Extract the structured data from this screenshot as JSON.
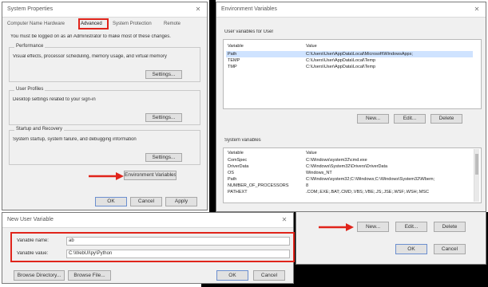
{
  "sysprops": {
    "title": "System Properties",
    "tabs": [
      "Computer Name",
      "Hardware",
      "Advanced",
      "System Protection",
      "Remote"
    ],
    "active_tab": "Advanced",
    "intro": "You must be logged on as an Administrator to make most of these changes.",
    "performance": {
      "label": "Performance",
      "desc": "Visual effects, processor scheduling, memory usage, and virtual memory",
      "button": "Settings..."
    },
    "profiles": {
      "label": "User Profiles",
      "desc": "Desktop settings related to your sign-in",
      "button": "Settings..."
    },
    "startup": {
      "label": "Startup and Recovery",
      "desc": "System startup, system failure, and debugging information",
      "button": "Settings..."
    },
    "env_button": "Environment Variables...",
    "ok": "OK",
    "cancel": "Cancel",
    "apply": "Apply"
  },
  "envvars": {
    "title": "Environment Variables",
    "user_section": "User variables for User",
    "col_variable": "Variable",
    "col_value": "Value",
    "user_vars": [
      {
        "name": "Path",
        "value": "C:\\Users\\User\\AppData\\Local\\Microsoft\\WindowsApps;"
      },
      {
        "name": "TEMP",
        "value": "C:\\Users\\User\\AppData\\Local\\Temp"
      },
      {
        "name": "TMP",
        "value": "C:\\Users\\User\\AppData\\Local\\Temp"
      }
    ],
    "user_buttons": [
      "New...",
      "Edit...",
      "Delete"
    ],
    "system_section": "System variables",
    "system_vars": [
      {
        "name": "Variable",
        "value": "Value"
      },
      {
        "name": "ComSpec",
        "value": "C:\\Windows\\system32\\cmd.exe"
      },
      {
        "name": "DriverData",
        "value": "C:\\Windows\\System32\\Drivers\\DriverData"
      },
      {
        "name": "OS",
        "value": "Windows_NT"
      },
      {
        "name": "Path",
        "value": "C:\\Windows\\system32;C:\\Windows;C:\\Windows\\System32\\Wbem;"
      },
      {
        "name": "NUMBER_OF_PROCESSORS",
        "value": "8"
      },
      {
        "name": "PATHEXT",
        "value": ".COM;.EXE;.BAT;.CMD;.VBS;.VBE;.JS;.JSE;.WSF;.WSH;.MSC"
      }
    ],
    "system_buttons": [
      "New...",
      "Edit...",
      "Delete"
    ],
    "ok": "OK",
    "cancel": "Cancel"
  },
  "newvar": {
    "title": "New User Variable",
    "name_label": "Variable name:",
    "name_value": "ab",
    "value_label": "Variable value:",
    "value_value": "C:\\WebUI\\py\\Python",
    "browse_dir": "Browse Directory...",
    "browse_file": "Browse File...",
    "ok": "OK",
    "cancel": "Cancel"
  },
  "colors": {
    "highlight": "#e0241b",
    "selection": "#cfe3ff",
    "background": "#000000"
  }
}
